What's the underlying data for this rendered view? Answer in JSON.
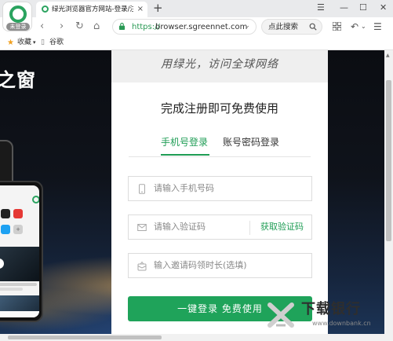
{
  "window": {
    "profile_badge": "未登录",
    "tab": {
      "title": "绿光浏览器官方网站-登录/注册",
      "close_glyph": "×"
    },
    "new_tab_glyph": "+",
    "controls": {
      "menu": "☰",
      "minimize": "—",
      "maximize": "☐",
      "close": "✕"
    }
  },
  "navbar": {
    "back": "‹",
    "forward": "›",
    "reload": "↻",
    "home": "⌂",
    "url_scheme": "https://",
    "url_host": "browser.sgreennet.com",
    "dropdown": "⌄",
    "search_label": "点此搜索"
  },
  "bookmarks": [
    {
      "label": "收藏",
      "icon": "star-icon"
    },
    {
      "label": "谷歌",
      "icon": "page-icon"
    }
  ],
  "page": {
    "hero_text": "之窗",
    "slogan": "用绿光，访问全球网络",
    "title": "完成注册即可免费使用",
    "tabs": {
      "phone_login": "手机号登录",
      "account_login": "账号密码登录"
    },
    "phone_placeholder": "请输入手机号码",
    "code_placeholder": "请输入验证码",
    "get_code": "获取验证码",
    "invite_placeholder": "输入邀请码领时长(选填)",
    "submit_label": "一键登录   免费使用"
  },
  "watermark": {
    "title": "下载银行",
    "sub": "www.downbank.cn"
  },
  "colors": {
    "brand_green": "#1fa35a",
    "tab_active": "#1f9d55"
  }
}
